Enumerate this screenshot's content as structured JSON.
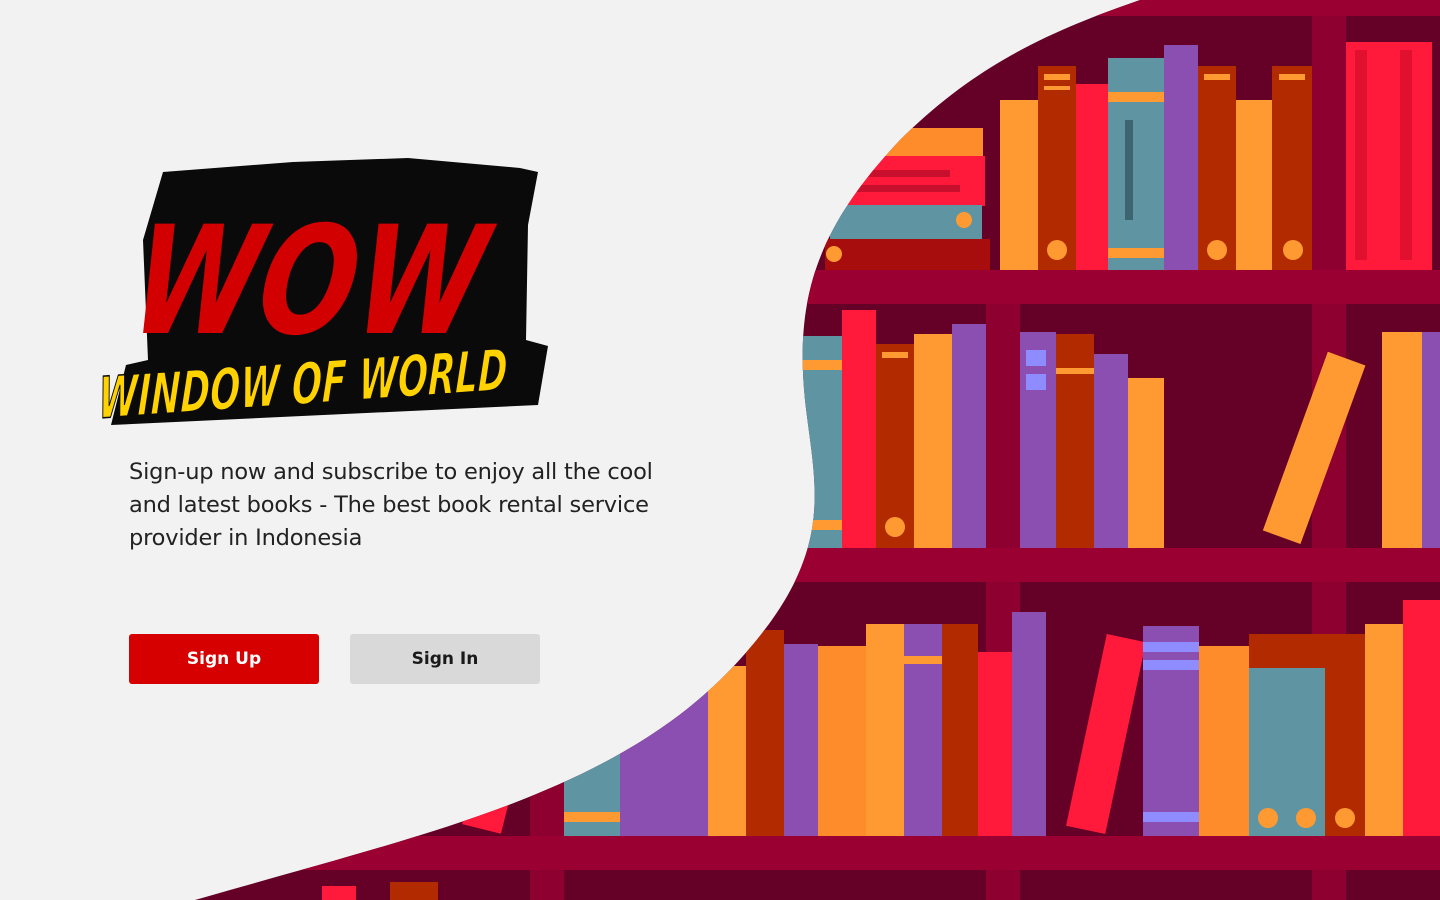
{
  "brand": {
    "logo_main": "WOW",
    "logo_sub": "WINDOW OF WORLD"
  },
  "hero": {
    "tagline": "Sign-up now and subscribe to enjoy all the cool and latest books - The best book rental service provider in Indonesia"
  },
  "actions": {
    "signup_label": "Sign Up",
    "signin_label": "Sign In"
  },
  "colors": {
    "accent": "#d70000",
    "logo_yellow": "#ffd200",
    "shelf_bg": "#650027",
    "shelf_plank": "#9a0032",
    "page_bg": "#f2f2f2",
    "secondary_button": "#d9d9d9"
  }
}
